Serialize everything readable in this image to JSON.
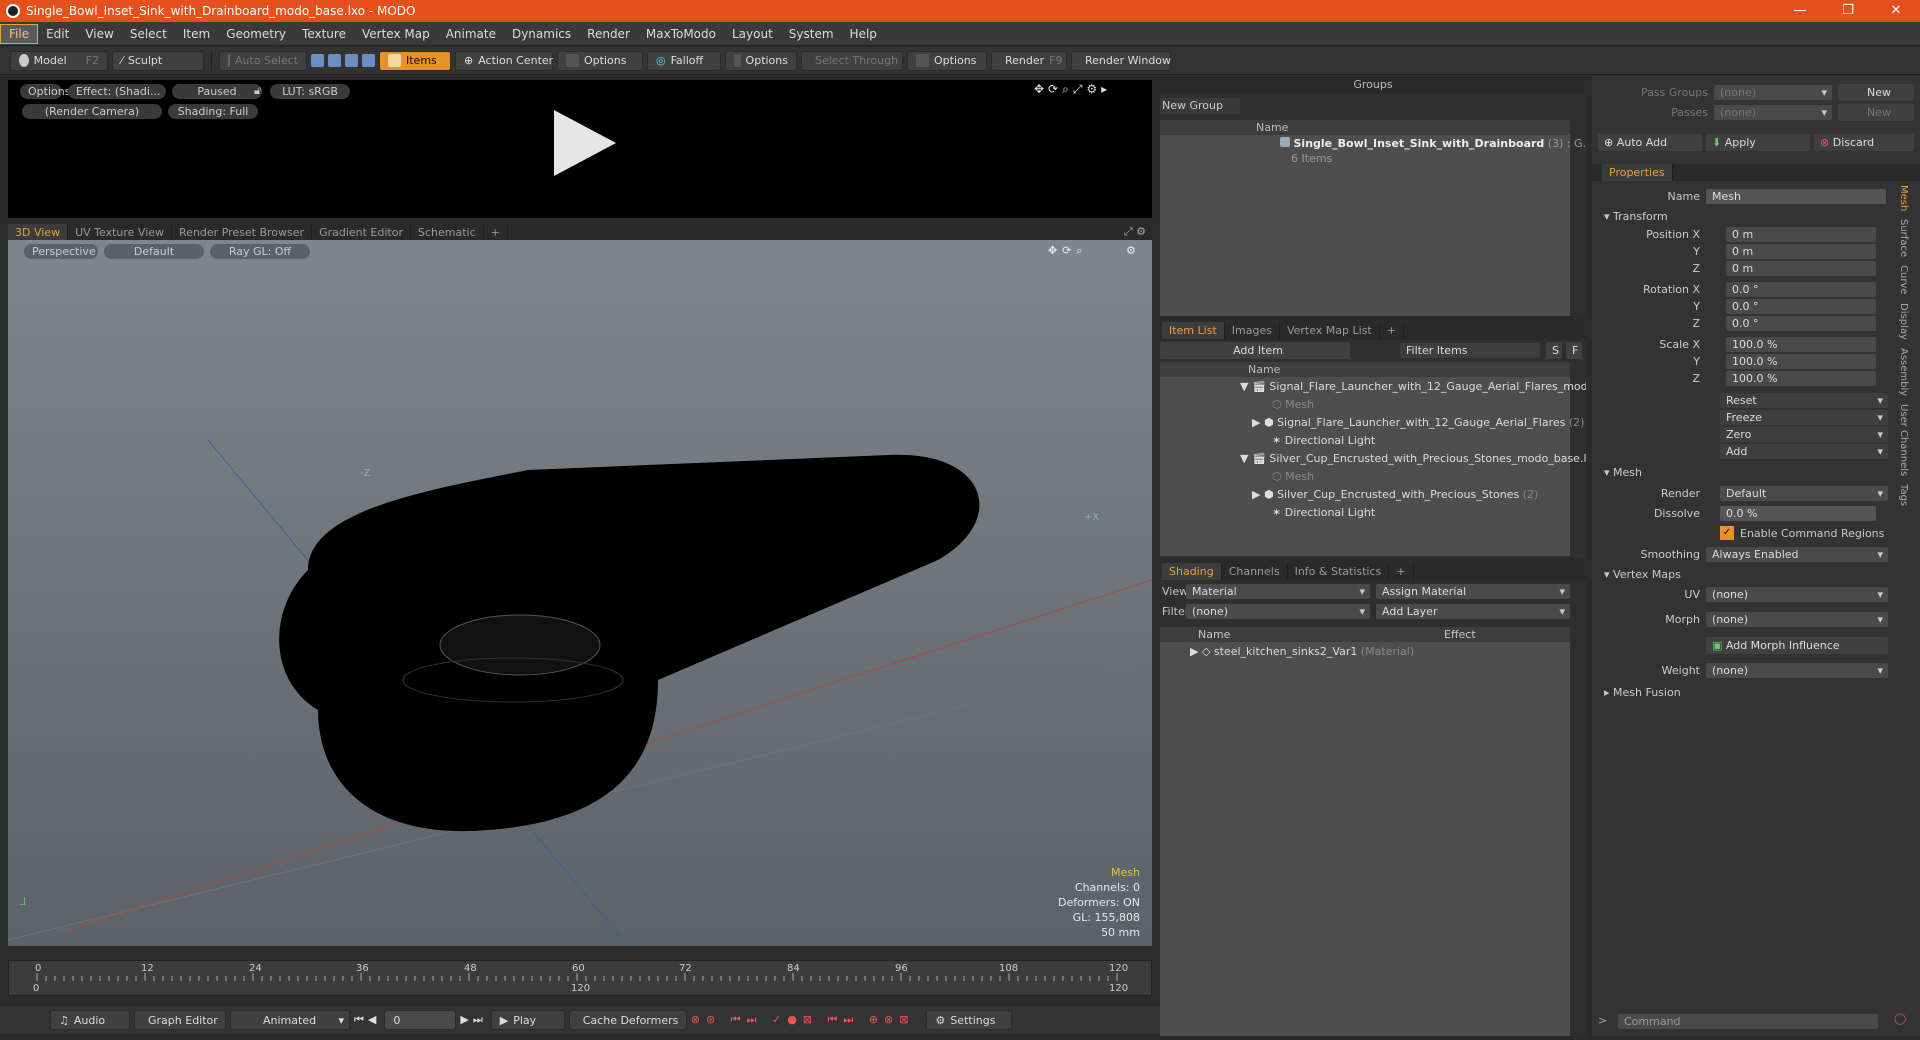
{
  "window": {
    "title": "Single_Bowl_Inset_Sink_with_Drainboard_modo_base.lxo - MODO"
  },
  "menu": [
    "File",
    "Edit",
    "View",
    "Select",
    "Item",
    "Geometry",
    "Texture",
    "Vertex Map",
    "Animate",
    "Dynamics",
    "Render",
    "MaxToModo",
    "Layout",
    "System",
    "Help"
  ],
  "toolbar": {
    "model": "Model",
    "model_key": "F2",
    "sculpt": "Sculpt",
    "auto_select": "Auto Select",
    "items": "Items",
    "action_center": "Action Center",
    "options1": "Options",
    "falloff": "Falloff",
    "options2": "Options",
    "select_through": "Select Through",
    "options3": "Options",
    "render": "Render",
    "render_key": "F9",
    "render_window": "Render Window"
  },
  "render_view": {
    "options": "Options",
    "effect": "Effect: (Shadi...",
    "paused": "Paused",
    "lut": "LUT: sRGB",
    "camera": "(Render Camera)",
    "shading": "Shading: Full"
  },
  "viewport_tabs": [
    "3D View",
    "UV Texture View",
    "Render Preset Browser",
    "Gradient Editor",
    "Schematic",
    "+"
  ],
  "viewport": {
    "perspective": "Perspective",
    "default": "Default",
    "raygl": "Ray GL: Off",
    "axis_z": "-Z",
    "axis_x": "+X"
  },
  "viewport_info": {
    "item": "Mesh",
    "channels": "Channels: 0",
    "deformers": "Deformers: ON",
    "gl": "GL: 155,808",
    "size": "50 mm"
  },
  "timeline": {
    "ticks": [
      "0",
      "12",
      "24",
      "36",
      "48",
      "60",
      "72",
      "84",
      "96",
      "108",
      "120"
    ],
    "sub_ticks": [
      "0",
      "120",
      "120"
    ]
  },
  "bottombar": {
    "audio": "Audio",
    "graph_editor": "Graph Editor",
    "animated": "Animated",
    "frame": "0",
    "play": "Play",
    "cache_deformers": "Cache Deformers",
    "settings": "Settings"
  },
  "groups": {
    "title": "Groups",
    "new_group": "New Group",
    "col_name": "Name",
    "item_name": "Single_Bowl_Inset_Sink_with_Drainboard",
    "item_count": "(3) : G...",
    "sub": "6 Items"
  },
  "item_list": {
    "tabs": [
      "Item List",
      "Images",
      "Vertex Map List",
      "+"
    ],
    "add_item": "Add Item",
    "filter": "Filter Items",
    "s_btn": "S",
    "f_btn": "F",
    "col_name": "Name",
    "rows": [
      {
        "label": "Signal_Flare_Launcher_with_12_Gauge_Aerial_Flares_mod...",
        "extra": "",
        "dim": false
      },
      {
        "label": "Mesh",
        "extra": "",
        "dim": true
      },
      {
        "label": "Signal_Flare_Launcher_with_12_Gauge_Aerial_Flares",
        "extra": "(2)",
        "dim": false
      },
      {
        "label": "Directional Light",
        "extra": "",
        "dim": false
      },
      {
        "label": "Silver_Cup_Encrusted_with_Precious_Stones_modo_base.lxo",
        "extra": "",
        "dim": false
      },
      {
        "label": "Mesh",
        "extra": "",
        "dim": true
      },
      {
        "label": "Silver_Cup_Encrusted_with_Precious_Stones",
        "extra": "(2)",
        "dim": false
      },
      {
        "label": "Directional Light",
        "extra": "",
        "dim": false
      }
    ]
  },
  "shading": {
    "tabs": [
      "Shading",
      "Channels",
      "Info & Statistics",
      "+"
    ],
    "view_label": "View",
    "view_value": "Material",
    "assign": "Assign Material",
    "filter_label": "Filter",
    "filter_value": "(none)",
    "add_layer": "Add Layer",
    "col_name": "Name",
    "col_effect": "Effect",
    "row": "steel_kitchen_sinks2_Var1",
    "row_type": "(Material)"
  },
  "right": {
    "pass_groups": "Pass Groups",
    "passes": "Passes",
    "none": "(none)",
    "new": "New",
    "auto_add": "Auto Add",
    "apply": "Apply",
    "discard": "Discard",
    "properties_tab": "Properties",
    "name_label": "Name",
    "name_value": "Mesh",
    "transform": "Transform",
    "position_x": "Position X",
    "rotation_x": "Rotation X",
    "scale_x": "Scale X",
    "y": "Y",
    "z": "Z",
    "pos_val": "0 m",
    "rot_val": "0.0 °",
    "scale_val": "100.0 %",
    "reset": "Reset",
    "freeze": "Freeze",
    "zero": "Zero",
    "add": "Add",
    "mesh": "Mesh",
    "render_label": "Render",
    "render_value": "Default",
    "dissolve_label": "Dissolve",
    "dissolve_value": "0.0 %",
    "enable_cmd": "Enable Command Regions",
    "smoothing_label": "Smoothing",
    "smoothing_value": "Always Enabled",
    "vertex_maps": "Vertex Maps",
    "uv_label": "UV",
    "morph_label": "Morph",
    "add_morph": "Add Morph Influence",
    "weight_label": "Weight",
    "mesh_fusion": "Mesh Fusion",
    "command": "Command",
    "vtabs": [
      "Mesh",
      "Surface",
      "Curve",
      "Display",
      "Assembly",
      "User Channels",
      "Tags"
    ]
  },
  "colors": {
    "accent": "#e8a040",
    "title": "#e5501c"
  }
}
